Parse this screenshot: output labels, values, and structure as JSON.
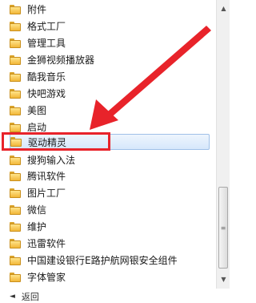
{
  "menu": {
    "items": [
      {
        "label": "附件"
      },
      {
        "label": "格式工厂"
      },
      {
        "label": "管理工具"
      },
      {
        "label": "金狮视频播放器"
      },
      {
        "label": "酷我音乐"
      },
      {
        "label": "快吧游戏"
      },
      {
        "label": "美图"
      },
      {
        "label": "启动"
      },
      {
        "label": "驱动精灵"
      },
      {
        "label": "搜狗输入法"
      },
      {
        "label": "腾讯软件"
      },
      {
        "label": "图片工厂"
      },
      {
        "label": "微信"
      },
      {
        "label": "维护"
      },
      {
        "label": "迅雷软件"
      },
      {
        "label": "中国建设银行E路护航网银安全组件"
      },
      {
        "label": "字体管家"
      }
    ],
    "selected_label": "驱动精灵",
    "bottom_label": "返回"
  },
  "scrollbar": {
    "up_glyph": "▲",
    "down_glyph": "▼",
    "thumb_glyph": "≡"
  },
  "annotation": {
    "color": "#e8232a",
    "icons": [
      "folder-icon",
      "red-arrow"
    ]
  }
}
